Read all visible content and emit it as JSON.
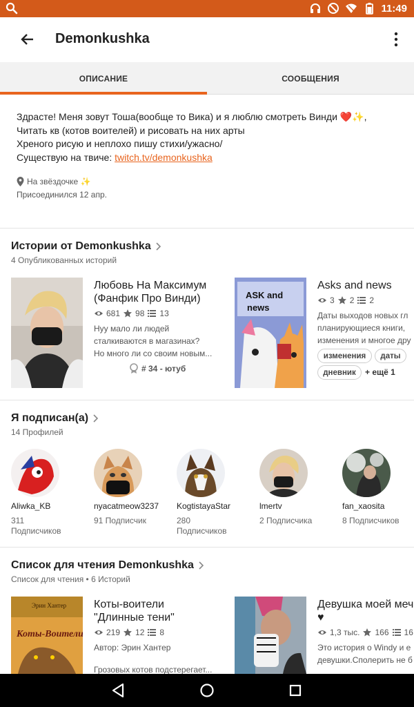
{
  "status_bar": {
    "time": "11:49"
  },
  "app_bar": {
    "title": "Demonkushka"
  },
  "tabs": [
    {
      "label": "ОПИСАНИЕ"
    },
    {
      "label": "СООБЩЕНИЯ"
    }
  ],
  "description": {
    "line1": "Здрасте! Меня зовут Тоша(вообще то Вика) и я люблю смотреть Винди ❤️✨,",
    "line2": "Читать кв (котов воителей) и рисовать на них арты",
    "line3": "Хреного рисую и неплохо пишу стихи/ужасно/",
    "line4_prefix": "Существую на твиче: ",
    "line4_link": "twitch.tv/demonkushka",
    "location": "На звёздочке ✨",
    "joined": "Присоединился 12 апр."
  },
  "stories_section": {
    "title": "Истории от Demonkushka",
    "subtitle": "4 Опубликованных историй",
    "stories": [
      {
        "title_line1": "Любовь На Максимум",
        "title_line2": "(Фанфик Про Винди)",
        "reads": "681",
        "votes": "98",
        "parts": "13",
        "blurb1": "Нуу мало ли людей",
        "blurb2": "сталкиваются в магазинах?",
        "blurb3": "Но много ли со своим новым...",
        "rank": "# 34 - ютуб"
      },
      {
        "title_line1": "Asks and news",
        "cover_text": "ASK and news",
        "reads": "3",
        "votes": "2",
        "parts": "2",
        "blurb1": "Даты выходов новых гл",
        "blurb2": "планирующиеся книги,",
        "blurb3": "изменения и многое дру",
        "tags": [
          "изменения",
          "даты",
          "дневник"
        ],
        "more_tags": "+ ещё 1"
      }
    ]
  },
  "following_section": {
    "title": "Я подписан(а)",
    "subtitle": "14 Профилей",
    "profiles": [
      {
        "name": "Aliwka_KB",
        "followers_line1": "311",
        "followers_line2": "Подписчиков"
      },
      {
        "name": "nyacatmeow3237",
        "followers_line1": "91 Подписчик",
        "followers_line2": ""
      },
      {
        "name": "KogtistayaStar",
        "followers_line1": "280",
        "followers_line2": "Подписчиков"
      },
      {
        "name": "lmertv",
        "followers_line1": "2 Подписчика",
        "followers_line2": ""
      },
      {
        "name": "fan_xaosita",
        "followers_line1": "8 Подписчиков",
        "followers_line2": ""
      }
    ]
  },
  "reading_list_section": {
    "title": "Список для чтения Demonkushka",
    "subtitle": "Список для чтения • 6 Историй",
    "stories": [
      {
        "title_line1": "Коты-воители",
        "title_line2": "\"Длинные тени\"",
        "cover_author": "Эрин Хантер",
        "cover_title": "Коты-Воители",
        "reads": "219",
        "votes": "12",
        "parts": "8",
        "author": "Автор: Эрин Хантер",
        "blurb1": "Грозовых котов подстерегает..."
      },
      {
        "title_line1": "Девушка моей меч",
        "title_line2": "♥",
        "reads": "1,3 тыс.",
        "votes": "166",
        "parts": "16",
        "blurb1": "Это история о Windy и е",
        "blurb2": "девушки.Сполерить не б"
      }
    ]
  },
  "colors": {
    "accent": "#e8641e",
    "status_bar": "#d35a1a"
  }
}
